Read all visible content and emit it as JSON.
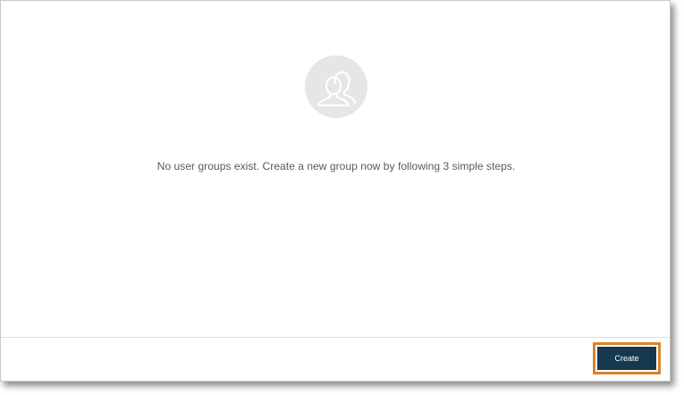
{
  "empty_state": {
    "icon": "user-group-icon",
    "message": "No user groups exist. Create a new group now by following 3 simple steps."
  },
  "footer": {
    "create_label": "Create"
  },
  "colors": {
    "primary_button": "#17394f",
    "highlight_border": "#d9822b",
    "icon_circle": "#e4e6e8",
    "icon_stroke": "#ffffff",
    "text": "#555a60"
  }
}
